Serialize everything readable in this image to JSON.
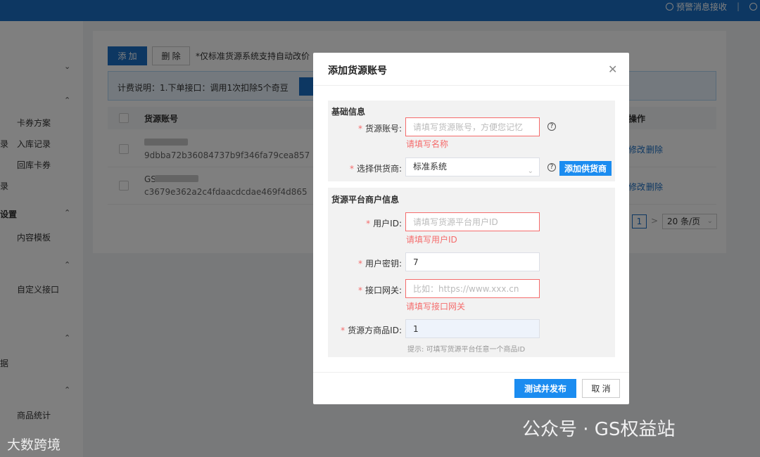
{
  "topbar": {
    "alert_label": "预警消息接收"
  },
  "sidebar": {
    "items": [
      "卡券方案",
      "入库记录",
      "回库卡券",
      "内容模板",
      "自定义接口",
      "商品统计"
    ],
    "fragments": [
      "录",
      "设置",
      "录",
      "据"
    ]
  },
  "toolbar": {
    "add_label": "添 加",
    "delete_label": "删 除",
    "note": "*仅标准货源系统支持自动改价"
  },
  "billing": {
    "text": "计费说明：1.下单接口：调用1次扣除5个奇豆"
  },
  "table": {
    "col_account": "货源账号",
    "col_ops": "操作",
    "rows": [
      {
        "name": "",
        "hash": "9dbba72b36084737b9f346fa79cea857",
        "edit": "修改",
        "delete": "删除"
      },
      {
        "name": "GS",
        "hash": "c3679e362a2c4fdaacdcdae469f4d865",
        "edit": "修改",
        "delete": "删除"
      }
    ]
  },
  "pagination": {
    "page": "1",
    "next": ">",
    "page_size": "20 条/页"
  },
  "modal": {
    "title": "添加货源账号",
    "section1": "基础信息",
    "account_label": "货源账号:",
    "account_placeholder": "请填写货源账号，方便您记忆",
    "account_error": "请填写名称",
    "supplier_label": "选择供货商:",
    "supplier_value": "标准系统",
    "add_supplier": "添加供货商",
    "section2": "货源平台商户信息",
    "userid_label": "用户ID:",
    "userid_placeholder": "请填写货源平台用户ID",
    "userid_error": "请填写用户ID",
    "secret_label": "用户密钥:",
    "secret_value": "7",
    "gateway_label": "接口网关:",
    "gateway_placeholder": "比如：https://www.xxx.cn",
    "gateway_error": "请填写接口网关",
    "product_label": "货源方商品ID:",
    "product_value": "1",
    "product_hint": "提示: 可填写货源平台任意一个商品ID",
    "submit": "测试并发布",
    "cancel": "取 消"
  },
  "watermarks": {
    "left": "大数跨境",
    "right": "公众号 · GS权益站"
  }
}
